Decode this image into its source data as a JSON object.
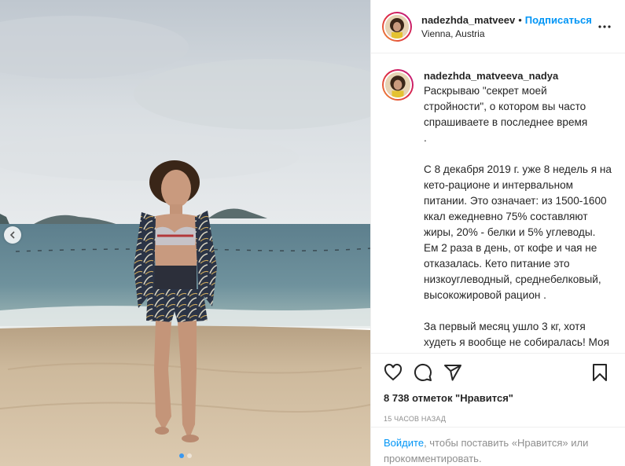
{
  "post": {
    "username": "nadezhda_matveeva_nadya",
    "username_truncated": "nadezhda_matveev",
    "separator": "•",
    "follow_label": "Подписаться",
    "location": "Vienna, Austria",
    "caption": "Раскрываю \"секрет моей стройности\", о котором вы часто спрашиваете в последнее время\n.\n\nС 8 декабря 2019 г. уже 8 недель я на кето-рационе и интервальном питании. Это означает: из 1500-1600 ккал ежедневно 75% составляют жиры, 20% - белки и 5% углеводы. Ем 2 раза в день, от кофе и чая не отказалась. Кето питание это низкоуглеводный, среднебелковый, высокожировой рацион .\n\nЗа первый месяц ушло 3 кг, хотя худеть я вообще не собиралась! Моя цель: избавиться от тяги к сладкому, ведь много лет я считала себя",
    "likes": "8 738 отметок \"Нравится\"",
    "time_ago": "15 часов назад",
    "login_link": "Войдите",
    "login_text": ", чтобы поставить «Нравится» или прокомментировать."
  },
  "icons": {
    "like": "heart-icon",
    "comment": "comment-icon",
    "share": "share-icon",
    "save": "bookmark-icon",
    "more": "more-icon",
    "prev": "chevron-left-icon"
  },
  "colors": {
    "accent": "#0095f6",
    "muted": "#8e8e8e",
    "text": "#262626",
    "border": "#efefef"
  }
}
